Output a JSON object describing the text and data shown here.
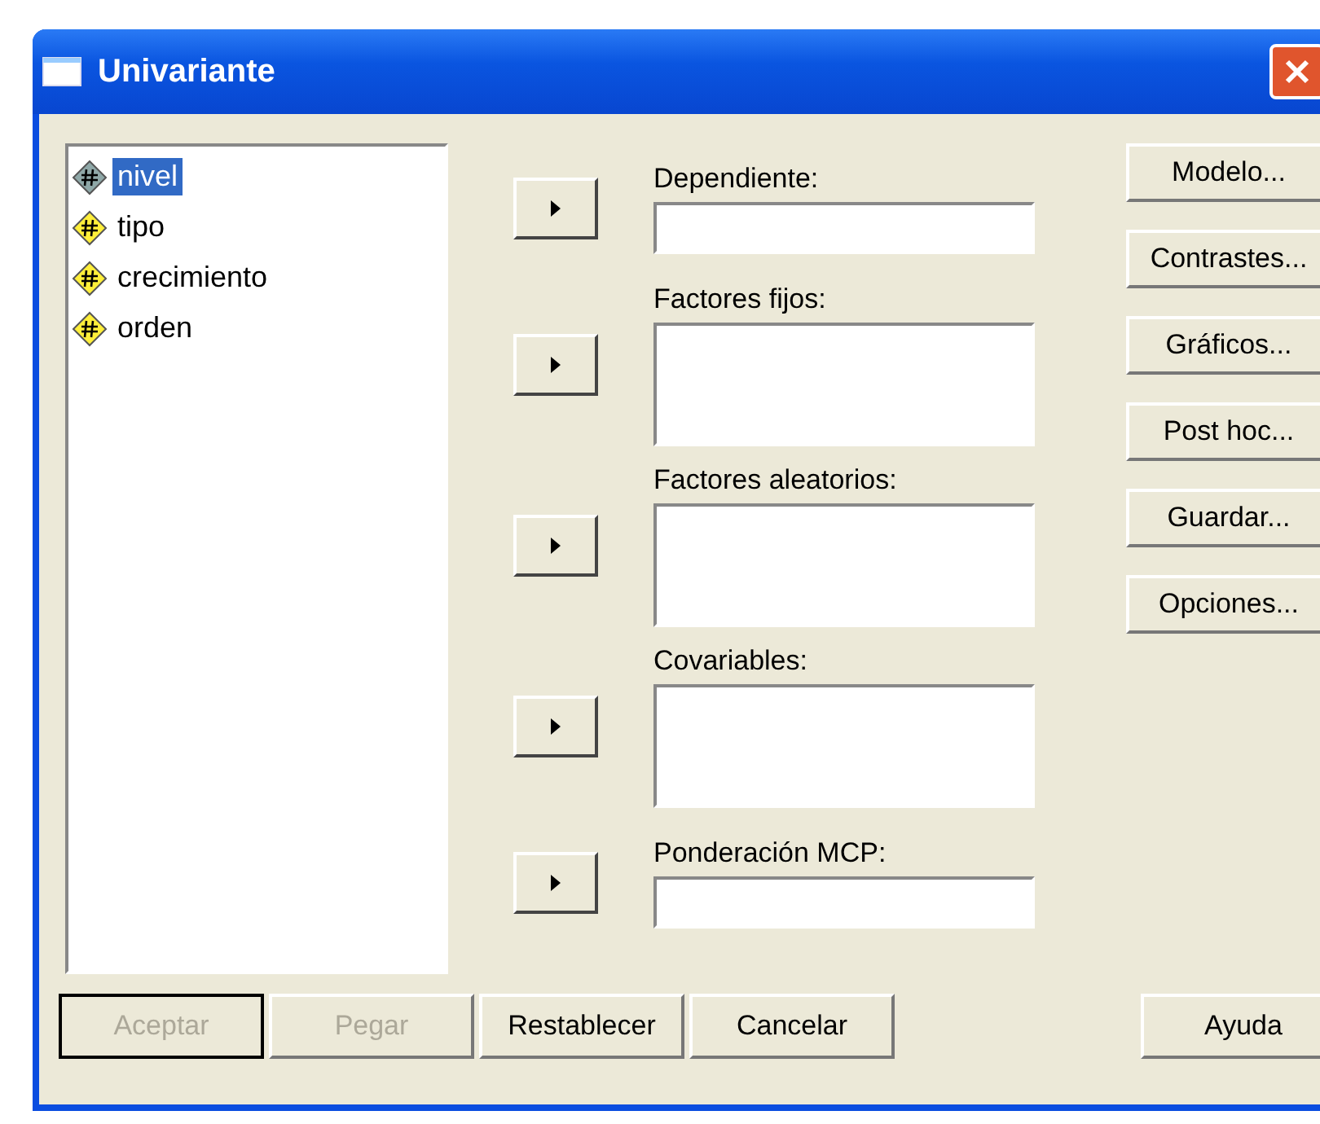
{
  "window": {
    "title": "Univariante"
  },
  "variables": [
    {
      "name": "nivel",
      "selected": true
    },
    {
      "name": "tipo",
      "selected": false
    },
    {
      "name": "crecimiento",
      "selected": false
    },
    {
      "name": "orden",
      "selected": false
    }
  ],
  "targets": [
    {
      "label": "Dependiente:",
      "kind": "single"
    },
    {
      "label": "Factores fijos:",
      "kind": "list"
    },
    {
      "label": "Factores aleatorios:",
      "kind": "list"
    },
    {
      "label": "Covariables:",
      "kind": "list"
    },
    {
      "label": "Ponderación MCP:",
      "kind": "single"
    }
  ],
  "side_buttons": [
    "Modelo...",
    "Contrastes...",
    "Gráficos...",
    "Post hoc...",
    "Guardar...",
    "Opciones..."
  ],
  "bottom_buttons": [
    {
      "label": "Aceptar",
      "disabled": true,
      "default": true
    },
    {
      "label": "Pegar",
      "disabled": true,
      "default": false
    },
    {
      "label": "Restablecer",
      "disabled": false,
      "default": false
    },
    {
      "label": "Cancelar",
      "disabled": false,
      "default": false
    }
  ],
  "help_button": "Ayuda"
}
